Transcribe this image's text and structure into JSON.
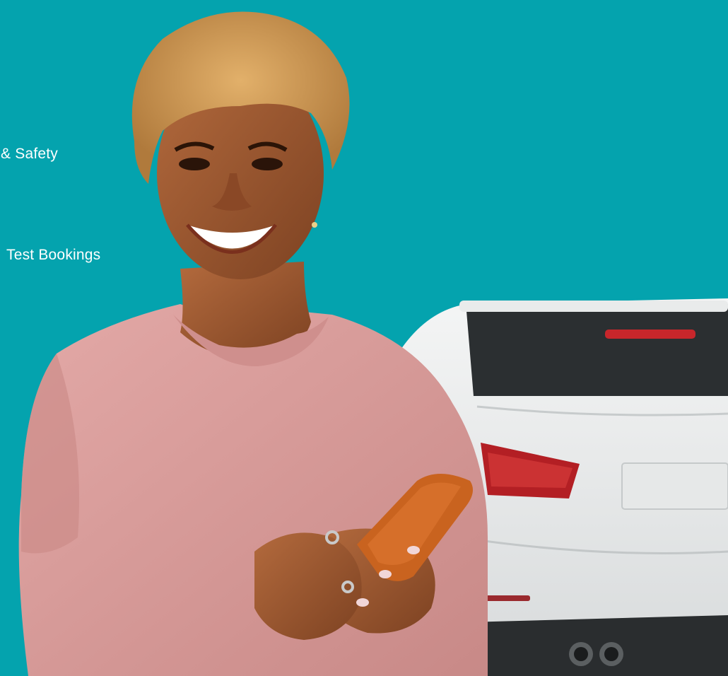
{
  "background_color": "#04a3ae",
  "menu_fragments": {
    "safety": "& Safety",
    "bookings": "Test Bookings"
  },
  "photo": {
    "subject": "smiling woman with curly blonde hair holding a phone, white car behind",
    "shirt_color": "#d69b9a",
    "phone_color": "#c9631f",
    "car_color": "#f0f1f1",
    "taillight_color": "#b31f24"
  }
}
